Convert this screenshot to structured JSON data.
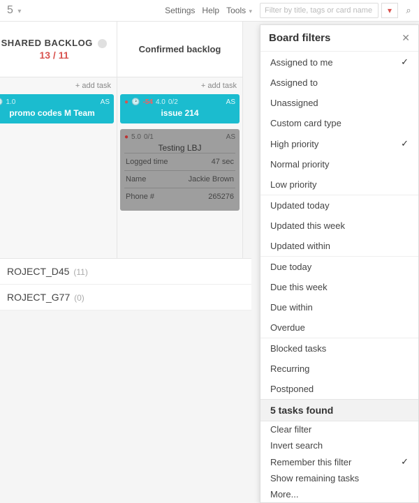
{
  "topbar": {
    "breadcrumb": "5",
    "links": {
      "settings": "Settings",
      "help": "Help",
      "tools": "Tools"
    },
    "filter_placeholder": "Filter by title, tags or card name"
  },
  "columns": [
    {
      "title": "SHARED BACKLOG",
      "count": "13 / 11",
      "add": "+ add task",
      "cards": [
        {
          "type": "teal",
          "clock": true,
          "est": "1.0",
          "initials": "AS",
          "title": "promo codes M Team"
        }
      ]
    },
    {
      "title": "Confirmed backlog",
      "add": "+ add task",
      "cards": [
        {
          "type": "teal",
          "pin": true,
          "clock": true,
          "est": "-54",
          "est_red": true,
          "est2": "4.0",
          "ratio": "0/2",
          "initials": "AS",
          "title": "issue 214"
        },
        {
          "type": "grey",
          "pin": true,
          "est": "5.0",
          "ratio": "0/1",
          "initials": "AS",
          "title": "Testing LBJ",
          "fields": [
            {
              "k": "Logged time",
              "v": "47 sec"
            },
            {
              "k": "Name",
              "v": "Jackie Brown"
            },
            {
              "k": "Phone #",
              "v": "265276"
            }
          ]
        }
      ]
    }
  ],
  "projects": [
    {
      "name": "ROJECT_D45",
      "count": "(11)"
    },
    {
      "name": "ROJECT_G77",
      "count": "(0)"
    }
  ],
  "panel": {
    "title": "Board filters",
    "groups": [
      [
        {
          "label": "Assigned to me",
          "checked": true
        },
        {
          "label": "Assigned to"
        },
        {
          "label": "Unassigned"
        },
        {
          "label": "Custom card type"
        },
        {
          "label": "High priority",
          "checked": true
        },
        {
          "label": "Normal priority"
        },
        {
          "label": "Low priority"
        }
      ],
      [
        {
          "label": "Updated today"
        },
        {
          "label": "Updated this week"
        },
        {
          "label": "Updated within"
        }
      ],
      [
        {
          "label": "Due today"
        },
        {
          "label": "Due this week"
        },
        {
          "label": "Due within"
        },
        {
          "label": "Overdue"
        }
      ],
      [
        {
          "label": "Blocked tasks"
        },
        {
          "label": "Recurring"
        },
        {
          "label": "Postponed"
        }
      ]
    ],
    "status": "5 tasks found",
    "actions": [
      {
        "label": "Clear filter"
      },
      {
        "label": "Invert search"
      },
      {
        "label": "Remember this filter",
        "checked": true
      },
      {
        "label": "Show remaining tasks"
      },
      {
        "label": "More..."
      }
    ]
  }
}
